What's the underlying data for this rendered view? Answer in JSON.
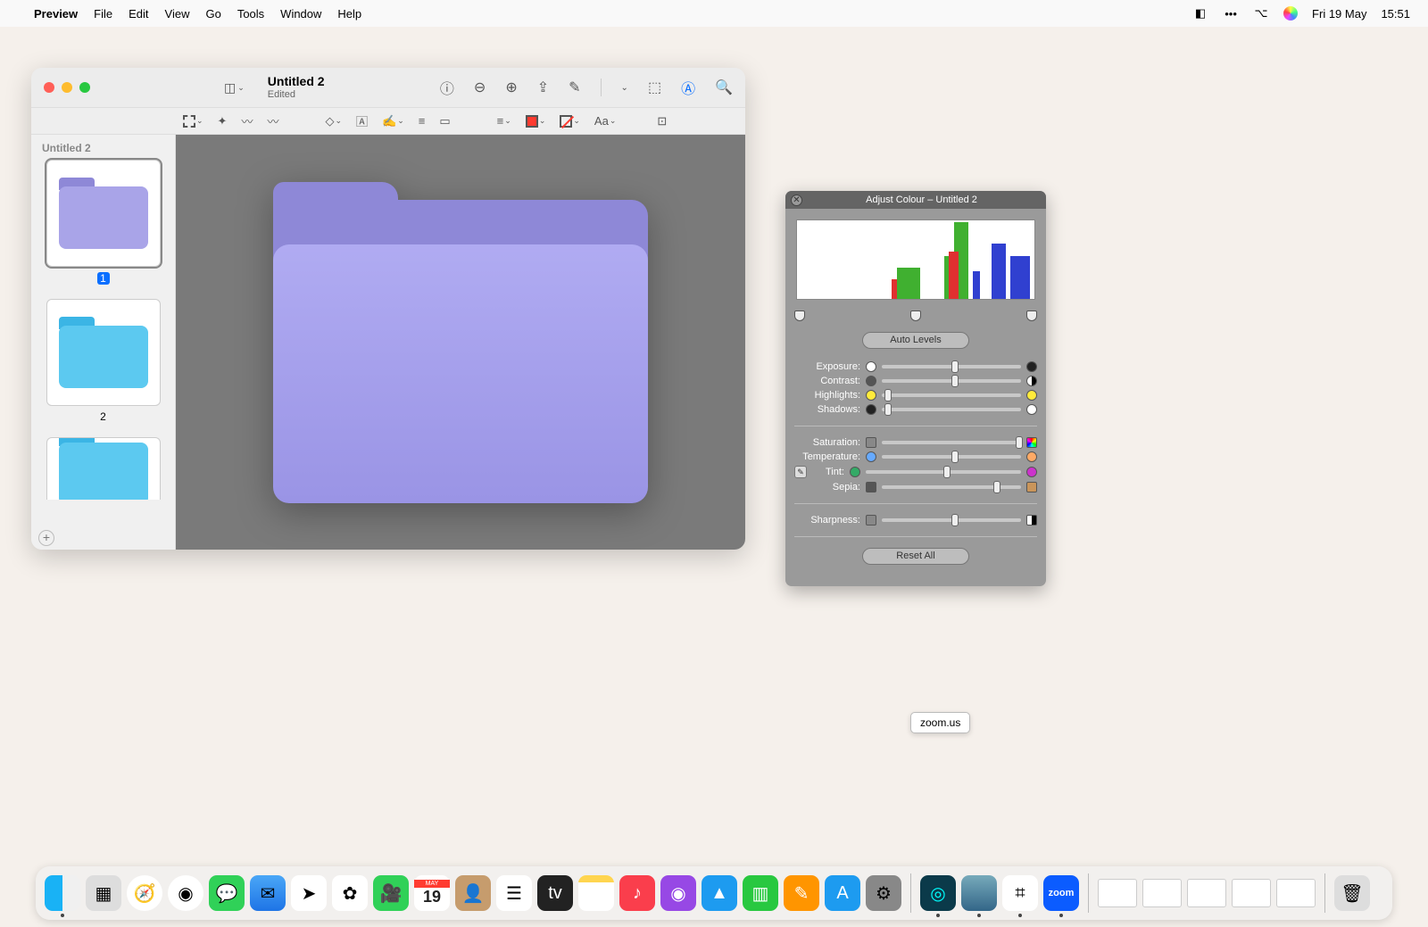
{
  "menubar": {
    "app": "Preview",
    "items": [
      "File",
      "Edit",
      "View",
      "Go",
      "Tools",
      "Window",
      "Help"
    ],
    "date": "Fri 19 May",
    "time": "15:51"
  },
  "window": {
    "title": "Untitled 2",
    "subtitle": "Edited",
    "sidebar_title": "Untitled 2",
    "pages": [
      "1",
      "2"
    ]
  },
  "markup": {
    "text_style": "Aa"
  },
  "adjust": {
    "title": "Adjust Colour – Untitled 2",
    "auto_levels": "Auto Levels",
    "reset_all": "Reset All",
    "labels": {
      "exposure": "Exposure:",
      "contrast": "Contrast:",
      "highlights": "Highlights:",
      "shadows": "Shadows:",
      "saturation": "Saturation:",
      "temperature": "Temperature:",
      "tint": "Tint:",
      "sepia": "Sepia:",
      "sharpness": "Sharpness:"
    },
    "values": {
      "exposure": 50,
      "contrast": 50,
      "highlights": 2,
      "shadows": 2,
      "saturation": 98,
      "temperature": 50,
      "tint": 50,
      "sepia": 80,
      "sharpness": 50
    }
  },
  "tooltip": {
    "zoom": "zoom.us"
  },
  "calendar": {
    "month": "MAY",
    "day": "19"
  },
  "dock": {
    "items": [
      "finder",
      "launchpad",
      "safari",
      "chrome",
      "messages",
      "mail",
      "maps",
      "photos",
      "facetime",
      "calendar",
      "contacts",
      "reminders",
      "tv",
      "notes",
      "music",
      "podcasts",
      "appstore-alt",
      "numbers",
      "pages",
      "app-store",
      "system-settings"
    ],
    "extra": [
      "app-a",
      "app-b",
      "slack",
      "zoom"
    ],
    "zoom_label": "zoom"
  }
}
